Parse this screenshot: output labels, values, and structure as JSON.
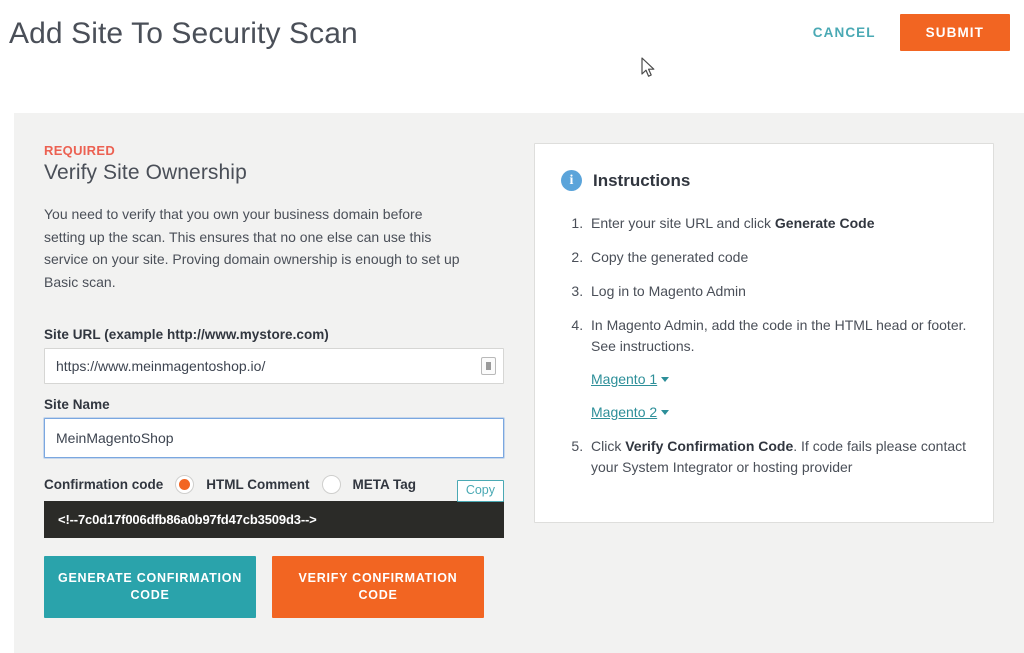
{
  "header": {
    "title": "Add Site To Security Scan",
    "cancel_label": "CANCEL",
    "submit_label": "SUBMIT"
  },
  "colors": {
    "accent_orange": "#f26522",
    "accent_teal": "#2aa3ab",
    "link_teal": "#2d8f99",
    "required_red": "#ec6152",
    "info_blue": "#5ba4da",
    "code_bg": "#2b2b28",
    "page_bg": "#f2f2f1"
  },
  "form": {
    "required_label": "REQUIRED",
    "section_title": "Verify Site Ownership",
    "intro": "You need to verify that you own your business domain before setting up the scan. This ensures that no one else can use this service on your site. Proving domain ownership is enough to set up Basic scan.",
    "site_url": {
      "label": "Site URL (example http://www.mystore.com)",
      "value": "https://www.meinmagentoshop.io/",
      "placeholder": "http://www.mystore.com"
    },
    "site_name": {
      "label": "Site Name",
      "value": "MeinMagentoShop",
      "placeholder": "Site Name"
    },
    "confirmation": {
      "label": "Confirmation code",
      "options": [
        {
          "label": "HTML Comment",
          "selected": true
        },
        {
          "label": "META Tag",
          "selected": false
        }
      ]
    },
    "copy_label": "Copy",
    "code": "<!--7c0d17f006dfb86a0b97fd47cb3509d3-->",
    "generate_label": "GENERATE CONFIRMATION CODE",
    "verify_label": "VERIFY CONFIRMATION CODE"
  },
  "instructions": {
    "icon": "info-icon",
    "title": "Instructions",
    "steps": [
      {
        "prefix": "Enter your site URL and click ",
        "bold": "Generate Code",
        "suffix": ""
      },
      {
        "prefix": "Copy the generated code",
        "bold": "",
        "suffix": ""
      },
      {
        "prefix": "Log in to Magento Admin",
        "bold": "",
        "suffix": ""
      },
      {
        "prefix": "In Magento Admin, add the code in the HTML head or footer. See instructions.",
        "bold": "",
        "suffix": ""
      },
      {
        "prefix": "Click ",
        "bold": "Verify Confirmation Code",
        "suffix": ". If code fails please contact your System Integrator or hosting provider"
      }
    ],
    "links": [
      {
        "label": "Magento 1"
      },
      {
        "label": "Magento 2"
      }
    ]
  }
}
